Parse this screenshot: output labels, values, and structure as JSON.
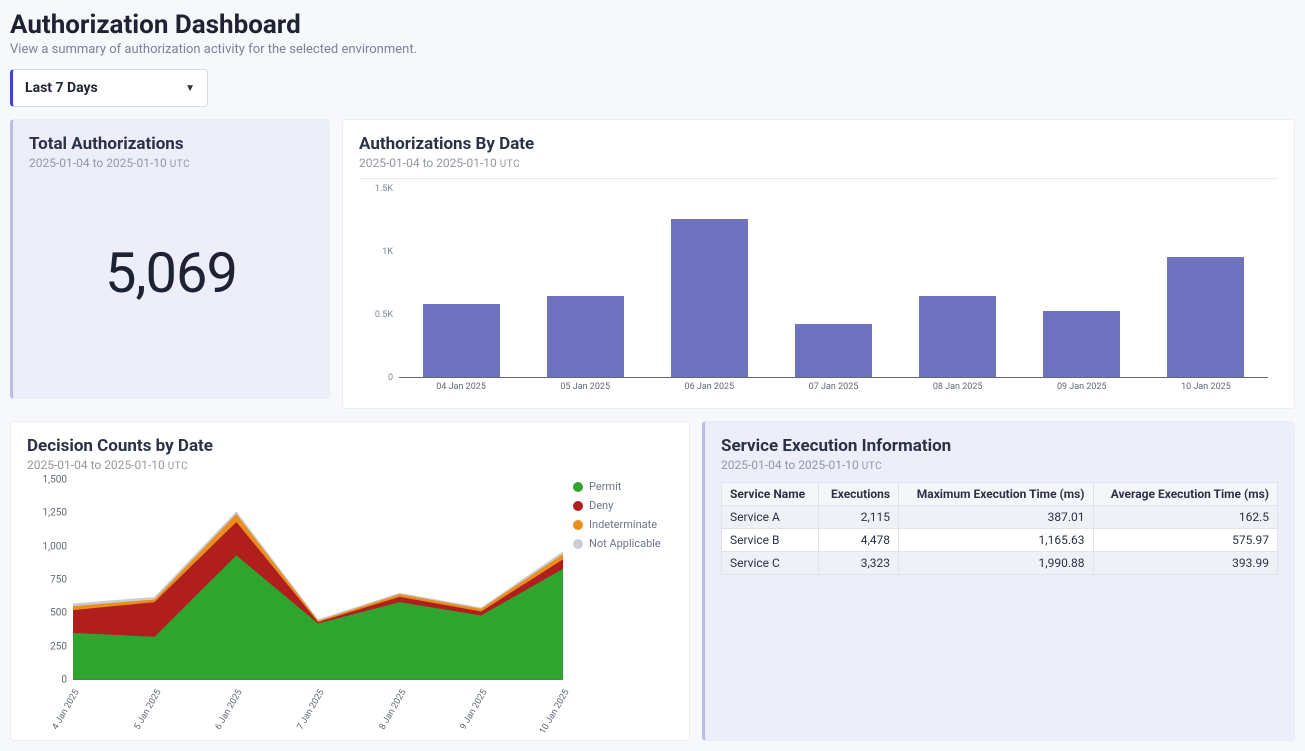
{
  "header": {
    "title": "Authorization Dashboard",
    "subtitle": "View a summary of authorization activity for the selected environment.",
    "date_range_label": "Last 7 Days"
  },
  "date_range_text": "2025-01-04 to 2025-01-10",
  "utc_label": "UTC",
  "cards": {
    "total": {
      "title": "Total Authorizations",
      "value": "5,069"
    },
    "by_date": {
      "title": "Authorizations By Date"
    },
    "decisions": {
      "title": "Decision Counts by Date"
    },
    "services": {
      "title": "Service Execution Information"
    }
  },
  "chart_data": [
    {
      "id": "authorizations_by_date",
      "type": "bar",
      "title": "Authorizations By Date",
      "categories": [
        "04 Jan 2025",
        "05 Jan 2025",
        "06 Jan 2025",
        "07 Jan 2025",
        "08 Jan 2025",
        "09 Jan 2025",
        "10 Jan 2025"
      ],
      "values": [
        580,
        650,
        1260,
        420,
        650,
        530,
        960
      ],
      "ylim": [
        0,
        1500
      ],
      "yticks": [
        0,
        500,
        1000,
        1500
      ],
      "ytick_labels": [
        "0",
        "0.5K",
        "1K",
        "1.5K"
      ]
    },
    {
      "id": "decision_counts_by_date",
      "type": "area",
      "title": "Decision Counts by Date",
      "categories": [
        "4 Jan 2025",
        "5 Jan 2025",
        "6 Jan 2025",
        "7 Jan 2025",
        "8 Jan 2025",
        "9 Jan 2025",
        "10 Jan 2025"
      ],
      "series": [
        {
          "name": "Permit",
          "color": "#2fa52f",
          "values": [
            350,
            320,
            930,
            420,
            580,
            480,
            830
          ]
        },
        {
          "name": "Deny",
          "color": "#b11e1e",
          "values": [
            170,
            260,
            250,
            10,
            40,
            30,
            70
          ]
        },
        {
          "name": "Indeterminate",
          "color": "#e88f1e",
          "values": [
            30,
            20,
            60,
            10,
            20,
            20,
            40
          ]
        },
        {
          "name": "Not Applicable",
          "color": "#c9ccd4",
          "values": [
            20,
            20,
            20,
            10,
            10,
            10,
            20
          ]
        }
      ],
      "ylim": [
        0,
        1500
      ],
      "yticks": [
        0,
        250,
        500,
        750,
        1000,
        1250,
        1500
      ]
    },
    {
      "id": "service_execution_information",
      "type": "table",
      "title": "Service Execution Information",
      "columns": [
        "Service Name",
        "Executions",
        "Maximum Execution Time (ms)",
        "Average Execution Time (ms)"
      ],
      "rows": [
        {
          "name": "Service A",
          "executions": "2,115",
          "max_ms": "387.01",
          "avg_ms": "162.5"
        },
        {
          "name": "Service B",
          "executions": "4,478",
          "max_ms": "1,165.63",
          "avg_ms": "575.97"
        },
        {
          "name": "Service C",
          "executions": "3,323",
          "max_ms": "1,990.88",
          "avg_ms": "393.99"
        }
      ]
    }
  ]
}
